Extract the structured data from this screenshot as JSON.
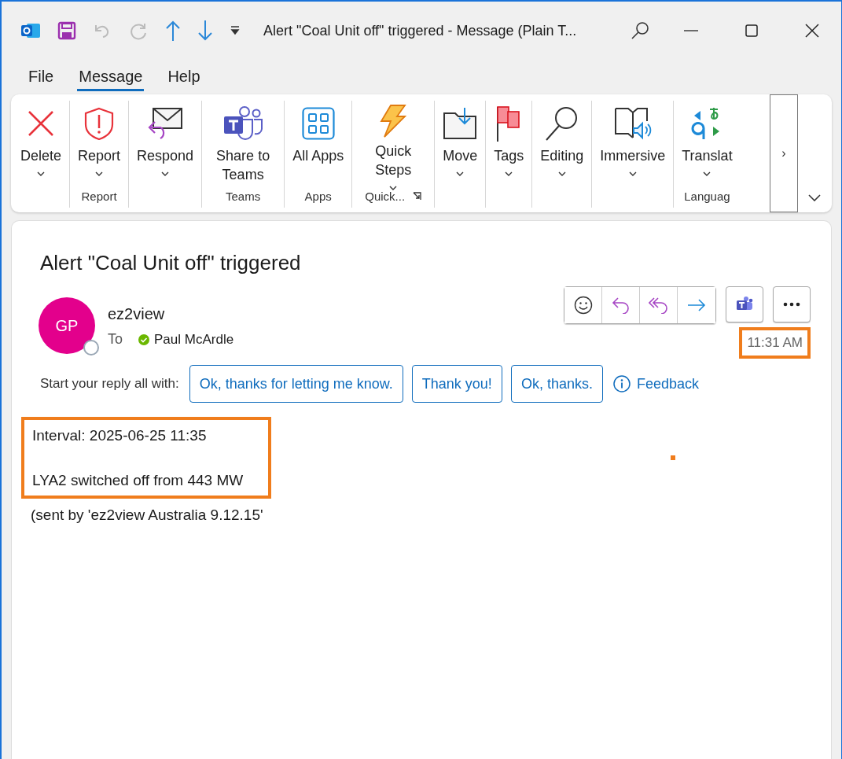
{
  "window": {
    "title": "Alert \"Coal Unit off\" triggered  -  Message (Plain T..."
  },
  "menu_tabs": [
    {
      "label": "File",
      "selected": false
    },
    {
      "label": "Message",
      "selected": true
    },
    {
      "label": "Help",
      "selected": false
    }
  ],
  "ribbon": {
    "groups": [
      {
        "buttons": [
          {
            "kind": "delete",
            "label": "Delete"
          }
        ]
      },
      {
        "label": "Report",
        "buttons": [
          {
            "kind": "report",
            "label": "Report"
          }
        ]
      },
      {
        "buttons": [
          {
            "kind": "respond",
            "label": "Respond"
          }
        ]
      },
      {
        "label": "Teams",
        "buttons": [
          {
            "kind": "teams",
            "label": "Share to Teams",
            "dropdown": false
          }
        ]
      },
      {
        "label": "Apps",
        "buttons": [
          {
            "kind": "apps",
            "label": "All Apps",
            "dropdown": false
          }
        ]
      },
      {
        "label": "Quick...",
        "launcher": true,
        "buttons": [
          {
            "kind": "quick",
            "label": "Quick Steps"
          }
        ]
      },
      {
        "buttons": [
          {
            "kind": "move",
            "label": "Move"
          }
        ]
      },
      {
        "buttons": [
          {
            "kind": "tags",
            "label": "Tags"
          }
        ]
      },
      {
        "buttons": [
          {
            "kind": "editing",
            "label": "Editing"
          }
        ]
      },
      {
        "buttons": [
          {
            "kind": "immersive",
            "label": "Immersive"
          }
        ]
      },
      {
        "label": "Languag",
        "buttons": [
          {
            "kind": "translate",
            "label": "Translat"
          }
        ]
      }
    ],
    "overflow": "›"
  },
  "message": {
    "subject": "Alert \"Coal Unit off\" triggered",
    "sender": {
      "initials": "GP",
      "name": "ez2view"
    },
    "to_label": "To",
    "recipient": "Paul McArdle",
    "time": "11:31 AM",
    "time_highlighted": true,
    "suggested_replies_label": "Start your reply all with:",
    "suggested_replies": [
      "Ok, thanks for letting me know.",
      "Thank you!",
      "Ok, thanks."
    ],
    "feedback": "Feedback",
    "body_highlighted": true,
    "body": [
      "Interval: 2025-06-25 11:35",
      "LYA2 switched off from 443 MW"
    ],
    "footer": "(sent by 'ez2view Australia 9.12.15'"
  }
}
